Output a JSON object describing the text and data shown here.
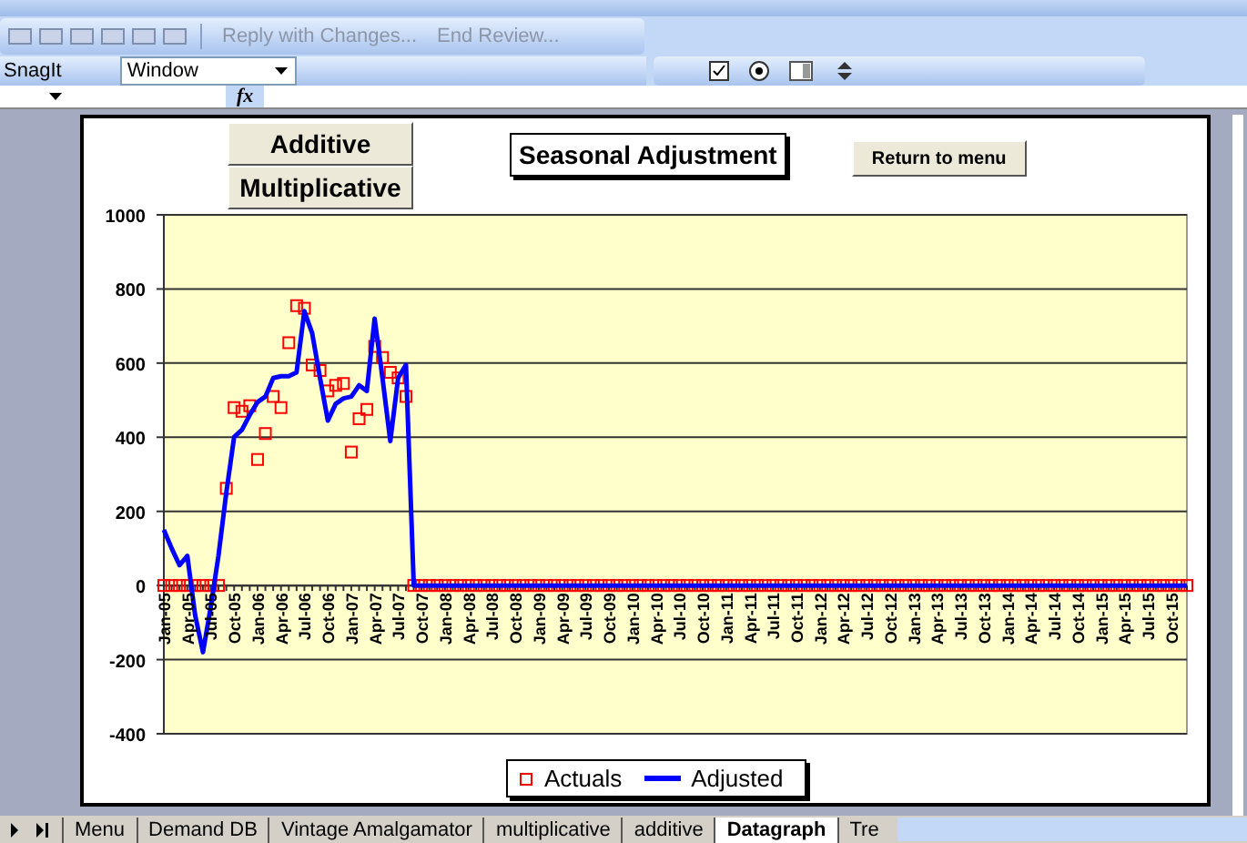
{
  "review_toolbar": {
    "buttons": [
      {
        "label": "Reply with Changes...",
        "disabled": true
      },
      {
        "label": "End Review...",
        "disabled": true
      }
    ]
  },
  "snagit_toolbar": {
    "label": "SnagIt",
    "dropdown": "Window"
  },
  "formula_bar": {
    "function_label": "fx"
  },
  "sheet": {
    "mode_buttons": [
      "Additive",
      "Multiplicative"
    ],
    "title": "Seasonal Adjustment",
    "menu_button": "Return to menu",
    "chart_data": {
      "type": "line",
      "categories": [
        "Jan-05",
        null,
        null,
        "Apr-05",
        null,
        null,
        "Jul-05",
        null,
        null,
        "Oct-05",
        null,
        null,
        "Jan-06",
        null,
        null,
        "Apr-06",
        null,
        null,
        "Jul-06",
        null,
        null,
        "Oct-06",
        null,
        null,
        "Jan-07",
        null,
        null,
        "Apr-07",
        null,
        null,
        "Jul-07",
        null,
        null,
        "Oct-07",
        null,
        null,
        "Jan-08",
        null,
        null,
        "Apr-08",
        null,
        null,
        "Jul-08",
        null,
        null,
        "Oct-08",
        null,
        null,
        "Jan-09",
        null,
        null,
        "Apr-09",
        null,
        null,
        "Jul-09",
        null,
        null,
        "Oct-09",
        null,
        null,
        "Jan-10",
        null,
        null,
        "Apr-10",
        null,
        null,
        "Jul-10",
        null,
        null,
        "Oct-10",
        null,
        null,
        "Jan-11",
        null,
        null,
        "Apr-11",
        null,
        null,
        "Jul-11",
        null,
        null,
        "Oct-11",
        null,
        null,
        "Jan-12",
        null,
        null,
        "Apr-12",
        null,
        null,
        "Jul-12",
        null,
        null,
        "Oct-12",
        null,
        null,
        "Jan-13",
        null,
        null,
        "Apr-13",
        null,
        null,
        "Jul-13",
        null,
        null,
        "Oct-13",
        null,
        null,
        "Jan-14",
        null,
        null,
        "Apr-14",
        null,
        null,
        "Jul-14",
        null,
        null,
        "Oct-14",
        null,
        null,
        "Jan-15",
        null,
        null,
        "Apr-15",
        null,
        null,
        "Jul-15",
        null,
        null,
        "Oct-15",
        null,
        null
      ],
      "series": [
        {
          "name": "Actuals",
          "type": "scatter",
          "marker": "square",
          "color": "#ff0000",
          "values": [
            0,
            0,
            0,
            0,
            0,
            0,
            0,
            0,
            262,
            480,
            470,
            485,
            340,
            410,
            510,
            480,
            655,
            755,
            748,
            595,
            580,
            525,
            540,
            545,
            360,
            450,
            475,
            645,
            615,
            575,
            560,
            510,
            0,
            0,
            0,
            0,
            0,
            0,
            0,
            0,
            0,
            0,
            0,
            0,
            0,
            0,
            0,
            0,
            0,
            0,
            0,
            0,
            0,
            0,
            0,
            0,
            0,
            0,
            0,
            0,
            0,
            0,
            0,
            0,
            0,
            0,
            0,
            0,
            0,
            0,
            0,
            0,
            0,
            0,
            0,
            0,
            0,
            0,
            0,
            0,
            0,
            0,
            0,
            0,
            0,
            0,
            0,
            0,
            0,
            0,
            0,
            0,
            0,
            0,
            0,
            0,
            0,
            0,
            0,
            0,
            0,
            0,
            0,
            0,
            0,
            0,
            0,
            0,
            0,
            0,
            0,
            0,
            0,
            0,
            0,
            0,
            0,
            0,
            0,
            0,
            0,
            0,
            0,
            0,
            0,
            0,
            0,
            0,
            0,
            0,
            0,
            0
          ]
        },
        {
          "name": "Adjusted",
          "type": "line",
          "color": "#0000ff",
          "values": [
            150,
            100,
            55,
            80,
            -80,
            -180,
            -60,
            80,
            250,
            400,
            420,
            460,
            495,
            510,
            560,
            565,
            565,
            575,
            740,
            680,
            560,
            445,
            490,
            505,
            510,
            540,
            525,
            720,
            560,
            390,
            560,
            595,
            0,
            0,
            0,
            0,
            0,
            0,
            0,
            0,
            0,
            0,
            0,
            0,
            0,
            0,
            0,
            0,
            0,
            0,
            0,
            0,
            0,
            0,
            0,
            0,
            0,
            0,
            0,
            0,
            0,
            0,
            0,
            0,
            0,
            0,
            0,
            0,
            0,
            0,
            0,
            0,
            0,
            0,
            0,
            0,
            0,
            0,
            0,
            0,
            0,
            0,
            0,
            0,
            0,
            0,
            0,
            0,
            0,
            0,
            0,
            0,
            0,
            0,
            0,
            0,
            0,
            0,
            0,
            0,
            0,
            0,
            0,
            0,
            0,
            0,
            0,
            0,
            0,
            0,
            0,
            0,
            0,
            0,
            0,
            0,
            0,
            0,
            0,
            0,
            0,
            0,
            0,
            0,
            0,
            0,
            0,
            0,
            0,
            0,
            0,
            0
          ]
        }
      ],
      "ylim": [
        -400,
        1000
      ],
      "grid": true,
      "yticks": [
        -400,
        -200,
        0,
        200,
        400,
        600,
        800,
        1000
      ]
    }
  },
  "sheet_tabs": [
    {
      "label": "Menu",
      "selected": false
    },
    {
      "label": "Demand DB",
      "selected": false
    },
    {
      "label": "Vintage Amalgamator",
      "selected": false
    },
    {
      "label": "multiplicative",
      "selected": false
    },
    {
      "label": "additive",
      "selected": false
    },
    {
      "label": "Datagraph",
      "selected": true
    },
    {
      "label": "Tre",
      "selected": false
    }
  ]
}
